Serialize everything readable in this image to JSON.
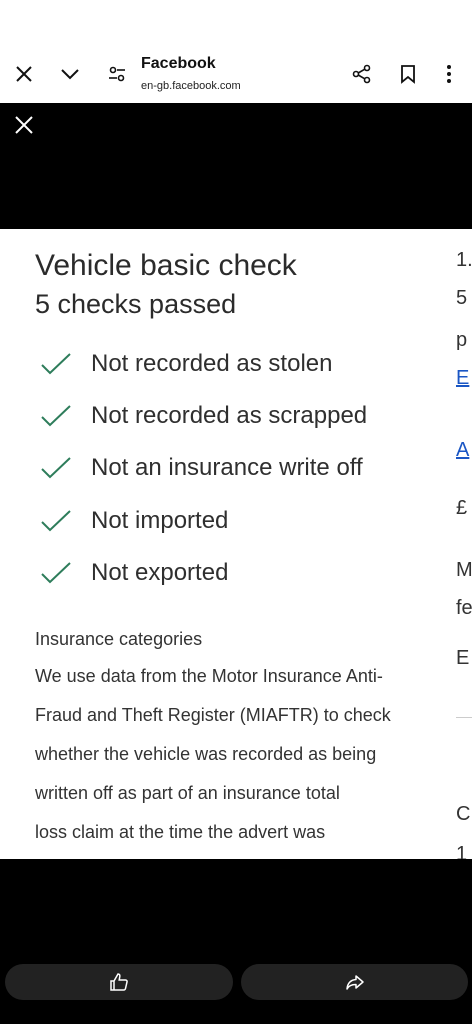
{
  "browser": {
    "title": "Facebook",
    "url": "en-gb.facebook.com",
    "icons": [
      "close-icon",
      "chevron-down-icon",
      "settings-sliders-icon",
      "share-icon",
      "bookmark-icon",
      "more-vertical-icon"
    ]
  },
  "card": {
    "heading": "Vehicle basic check",
    "subheading": "5 checks passed",
    "checks": [
      "Not recorded as stolen",
      "Not recorded as scrapped",
      "Not an insurance write off",
      "Not imported",
      "Not exported"
    ],
    "insurance_heading": "Insurance categories",
    "insurance_lines": [
      "We use data from the Motor Insurance Anti-",
      "Fraud and Theft Register (MIAFTR) to check",
      "whether the vehicle was recorded as being",
      "written off as part of an insurance total",
      "loss claim at the time the advert was"
    ]
  },
  "peek": [
    "1.",
    "5",
    "p",
    "E",
    "A",
    "£",
    "M",
    "fe",
    "E",
    "C",
    "1"
  ],
  "colors": {
    "check": "#2e7d5b",
    "link": "#1a56c4"
  }
}
